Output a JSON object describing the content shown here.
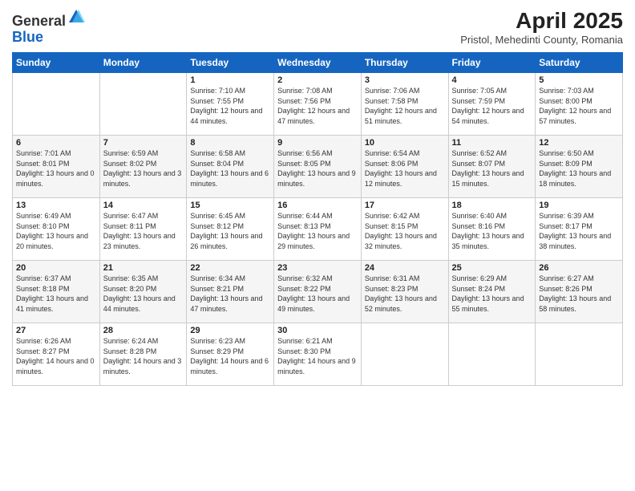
{
  "logo": {
    "general": "General",
    "blue": "Blue"
  },
  "title": "April 2025",
  "subtitle": "Pristol, Mehedinti County, Romania",
  "days_header": [
    "Sunday",
    "Monday",
    "Tuesday",
    "Wednesday",
    "Thursday",
    "Friday",
    "Saturday"
  ],
  "weeks": [
    [
      {
        "num": "",
        "info": ""
      },
      {
        "num": "",
        "info": ""
      },
      {
        "num": "1",
        "info": "Sunrise: 7:10 AM\nSunset: 7:55 PM\nDaylight: 12 hours\nand 44 minutes."
      },
      {
        "num": "2",
        "info": "Sunrise: 7:08 AM\nSunset: 7:56 PM\nDaylight: 12 hours\nand 47 minutes."
      },
      {
        "num": "3",
        "info": "Sunrise: 7:06 AM\nSunset: 7:58 PM\nDaylight: 12 hours\nand 51 minutes."
      },
      {
        "num": "4",
        "info": "Sunrise: 7:05 AM\nSunset: 7:59 PM\nDaylight: 12 hours\nand 54 minutes."
      },
      {
        "num": "5",
        "info": "Sunrise: 7:03 AM\nSunset: 8:00 PM\nDaylight: 12 hours\nand 57 minutes."
      }
    ],
    [
      {
        "num": "6",
        "info": "Sunrise: 7:01 AM\nSunset: 8:01 PM\nDaylight: 13 hours\nand 0 minutes."
      },
      {
        "num": "7",
        "info": "Sunrise: 6:59 AM\nSunset: 8:02 PM\nDaylight: 13 hours\nand 3 minutes."
      },
      {
        "num": "8",
        "info": "Sunrise: 6:58 AM\nSunset: 8:04 PM\nDaylight: 13 hours\nand 6 minutes."
      },
      {
        "num": "9",
        "info": "Sunrise: 6:56 AM\nSunset: 8:05 PM\nDaylight: 13 hours\nand 9 minutes."
      },
      {
        "num": "10",
        "info": "Sunrise: 6:54 AM\nSunset: 8:06 PM\nDaylight: 13 hours\nand 12 minutes."
      },
      {
        "num": "11",
        "info": "Sunrise: 6:52 AM\nSunset: 8:07 PM\nDaylight: 13 hours\nand 15 minutes."
      },
      {
        "num": "12",
        "info": "Sunrise: 6:50 AM\nSunset: 8:09 PM\nDaylight: 13 hours\nand 18 minutes."
      }
    ],
    [
      {
        "num": "13",
        "info": "Sunrise: 6:49 AM\nSunset: 8:10 PM\nDaylight: 13 hours\nand 20 minutes."
      },
      {
        "num": "14",
        "info": "Sunrise: 6:47 AM\nSunset: 8:11 PM\nDaylight: 13 hours\nand 23 minutes."
      },
      {
        "num": "15",
        "info": "Sunrise: 6:45 AM\nSunset: 8:12 PM\nDaylight: 13 hours\nand 26 minutes."
      },
      {
        "num": "16",
        "info": "Sunrise: 6:44 AM\nSunset: 8:13 PM\nDaylight: 13 hours\nand 29 minutes."
      },
      {
        "num": "17",
        "info": "Sunrise: 6:42 AM\nSunset: 8:15 PM\nDaylight: 13 hours\nand 32 minutes."
      },
      {
        "num": "18",
        "info": "Sunrise: 6:40 AM\nSunset: 8:16 PM\nDaylight: 13 hours\nand 35 minutes."
      },
      {
        "num": "19",
        "info": "Sunrise: 6:39 AM\nSunset: 8:17 PM\nDaylight: 13 hours\nand 38 minutes."
      }
    ],
    [
      {
        "num": "20",
        "info": "Sunrise: 6:37 AM\nSunset: 8:18 PM\nDaylight: 13 hours\nand 41 minutes."
      },
      {
        "num": "21",
        "info": "Sunrise: 6:35 AM\nSunset: 8:20 PM\nDaylight: 13 hours\nand 44 minutes."
      },
      {
        "num": "22",
        "info": "Sunrise: 6:34 AM\nSunset: 8:21 PM\nDaylight: 13 hours\nand 47 minutes."
      },
      {
        "num": "23",
        "info": "Sunrise: 6:32 AM\nSunset: 8:22 PM\nDaylight: 13 hours\nand 49 minutes."
      },
      {
        "num": "24",
        "info": "Sunrise: 6:31 AM\nSunset: 8:23 PM\nDaylight: 13 hours\nand 52 minutes."
      },
      {
        "num": "25",
        "info": "Sunrise: 6:29 AM\nSunset: 8:24 PM\nDaylight: 13 hours\nand 55 minutes."
      },
      {
        "num": "26",
        "info": "Sunrise: 6:27 AM\nSunset: 8:26 PM\nDaylight: 13 hours\nand 58 minutes."
      }
    ],
    [
      {
        "num": "27",
        "info": "Sunrise: 6:26 AM\nSunset: 8:27 PM\nDaylight: 14 hours\nand 0 minutes."
      },
      {
        "num": "28",
        "info": "Sunrise: 6:24 AM\nSunset: 8:28 PM\nDaylight: 14 hours\nand 3 minutes."
      },
      {
        "num": "29",
        "info": "Sunrise: 6:23 AM\nSunset: 8:29 PM\nDaylight: 14 hours\nand 6 minutes."
      },
      {
        "num": "30",
        "info": "Sunrise: 6:21 AM\nSunset: 8:30 PM\nDaylight: 14 hours\nand 9 minutes."
      },
      {
        "num": "",
        "info": ""
      },
      {
        "num": "",
        "info": ""
      },
      {
        "num": "",
        "info": ""
      }
    ]
  ]
}
